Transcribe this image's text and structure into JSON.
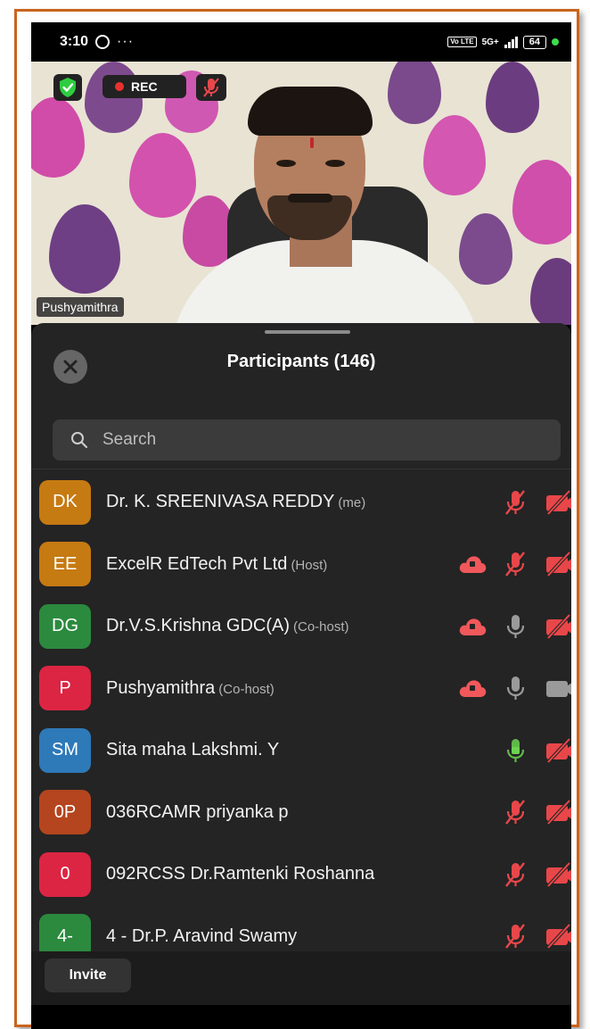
{
  "status_bar": {
    "time": "3:10",
    "dots": "···",
    "volte": "Vo LTE",
    "network": "5G+",
    "battery": "64"
  },
  "video": {
    "rec_label": "REC",
    "speaker_name": "Pushyamithra"
  },
  "panel": {
    "title": "Participants (146)",
    "search_placeholder": "Search"
  },
  "participants": [
    {
      "initials": "DK",
      "avatar_color": "#c67a12",
      "name": "Dr. K. SREENIVASA REDDY",
      "role": "(me)",
      "cloud": false,
      "mic": "muted",
      "cam": "off"
    },
    {
      "initials": "EE",
      "avatar_color": "#c67a12",
      "name": "ExcelR EdTech Pvt Ltd",
      "role": "(Host)",
      "cloud": true,
      "mic": "muted",
      "cam": "off"
    },
    {
      "initials": "DG",
      "avatar_color": "#2b8a3e",
      "name": "Dr.V.S.Krishna GDC(A)",
      "role": "(Co-host)",
      "cloud": true,
      "mic": "on",
      "cam": "off"
    },
    {
      "initials": "P",
      "avatar_color": "#dc2543",
      "name": "Pushyamithra",
      "role": "(Co-host)",
      "cloud": true,
      "mic": "on",
      "cam": "on"
    },
    {
      "initials": "SM",
      "avatar_color": "#2e79b8",
      "name": "Sita maha Lakshmi. Y",
      "role": "",
      "cloud": false,
      "mic": "speaking",
      "cam": "off"
    },
    {
      "initials": "0P",
      "avatar_color": "#b4451e",
      "name": "036RCAMR priyanka p",
      "role": "",
      "cloud": false,
      "mic": "muted",
      "cam": "off"
    },
    {
      "initials": "0",
      "avatar_color": "#dc2543",
      "name": "092RCSS  Dr.Ramtenki Roshanna",
      "role": "",
      "cloud": false,
      "mic": "muted",
      "cam": "off"
    },
    {
      "initials": "4-",
      "avatar_color": "#2b8a3e",
      "name": "4 - Dr.P. Aravind Swamy",
      "role": "",
      "cloud": false,
      "mic": "muted",
      "cam": "off"
    }
  ],
  "footer": {
    "invite_label": "Invite"
  },
  "colors": {
    "muted_red": "#e8474a",
    "cloud_red": "#f0585b",
    "mic_gray": "#9a9a9a",
    "mic_green": "#5fb84a",
    "panel_bg": "#242424"
  }
}
